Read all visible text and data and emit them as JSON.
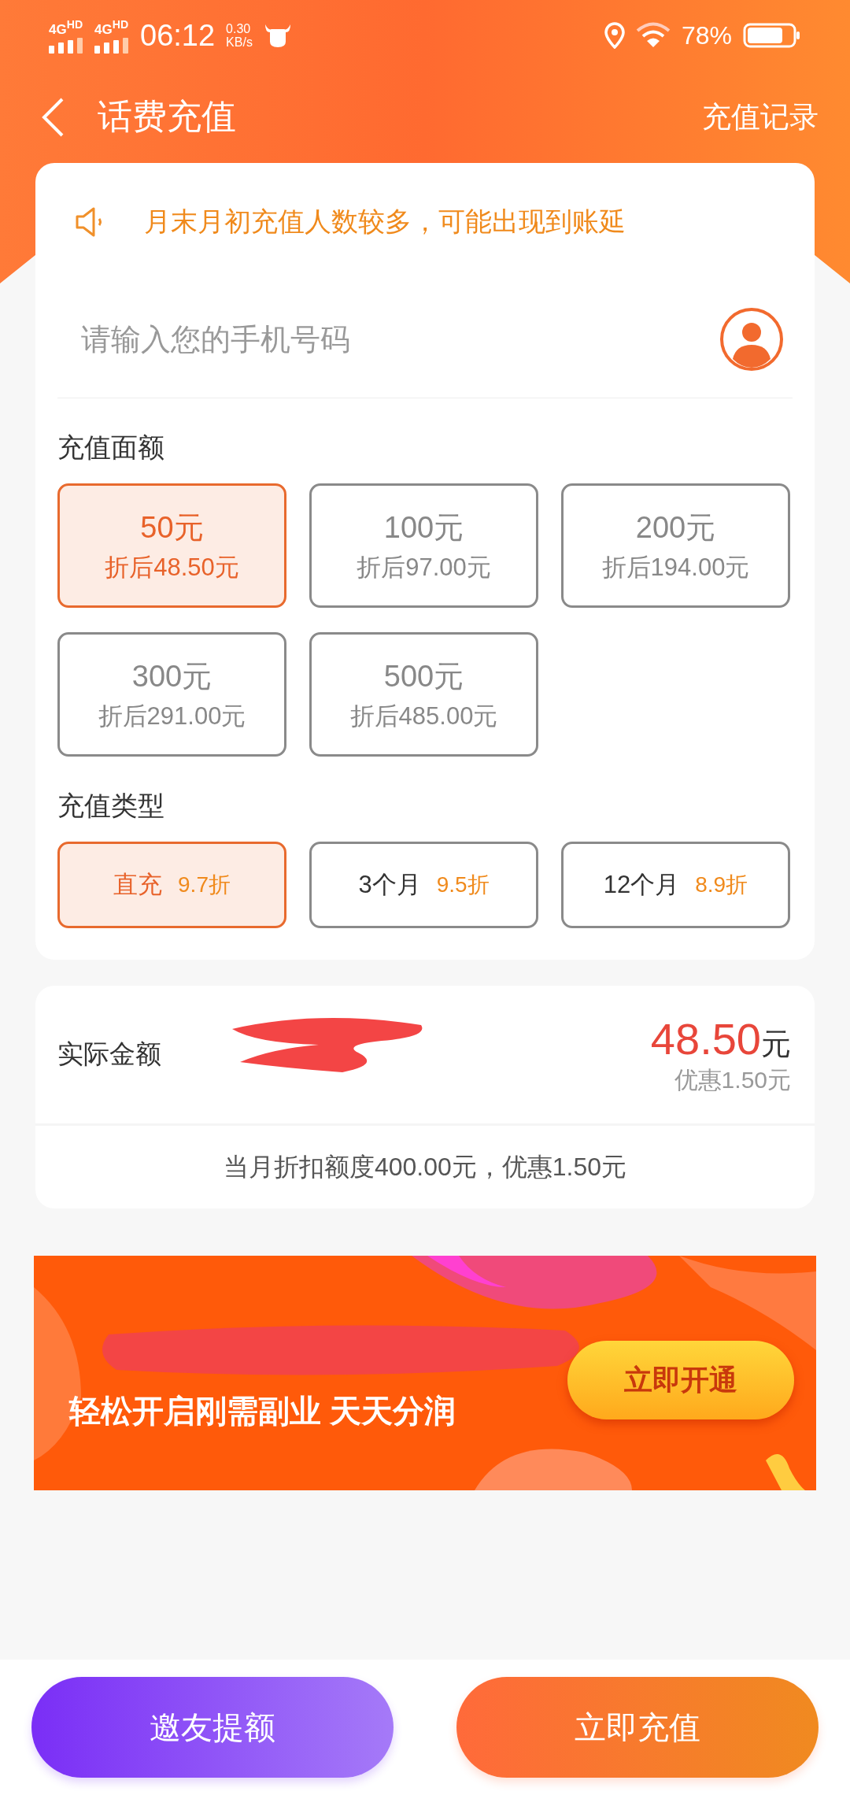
{
  "status_bar": {
    "networks": [
      "4G$^{HD}$",
      "4G$^{HD}$"
    ],
    "time": "06:12",
    "speed": "0.30",
    "speed_unit": "KB/s",
    "battery": "78%"
  },
  "header": {
    "title": "话费充值",
    "action": "充值记录"
  },
  "notice": {
    "text": "月末月初充值人数较多，可能出现到账延"
  },
  "phone_input": {
    "placeholder": "请输入您的手机号码"
  },
  "amount_section": {
    "label": "充值面额",
    "options": [
      {
        "amount": "50元",
        "discounted": "折后48.50元",
        "selected": true
      },
      {
        "amount": "100元",
        "discounted": "折后97.00元",
        "selected": false
      },
      {
        "amount": "200元",
        "discounted": "折后194.00元",
        "selected": false
      },
      {
        "amount": "300元",
        "discounted": "折后291.00元",
        "selected": false
      },
      {
        "amount": "500元",
        "discounted": "折后485.00元",
        "selected": false
      }
    ]
  },
  "type_section": {
    "label": "充值类型",
    "options": [
      {
        "name": "直充",
        "discount": "9.7折",
        "selected": true
      },
      {
        "name": "3个月",
        "discount": "9.5折",
        "selected": false
      },
      {
        "name": "12个月",
        "discount": "8.9折",
        "selected": false
      }
    ]
  },
  "summary": {
    "label": "实际金额",
    "price": "48.50",
    "unit": "元",
    "saving": "优惠1.50元",
    "note": "当月折扣额度400.00元，优惠1.50元"
  },
  "banner": {
    "subtitle": "轻松开启刚需副业 天天分润",
    "button": "立即开通"
  },
  "buttons": [
    {
      "label": "邀友提额",
      "kind": "invite"
    },
    {
      "label": "立即充值",
      "kind": "recharge"
    }
  ]
}
